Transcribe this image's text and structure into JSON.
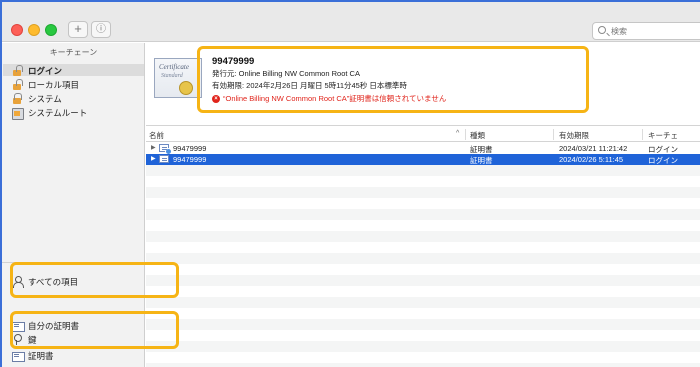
{
  "toolbar": {
    "add_button": "+",
    "info_button": "ⓘ",
    "search_placeholder": "検索"
  },
  "sidebar": {
    "keychains_header": "キーチェーン",
    "keychains": [
      {
        "label": "ログイン",
        "icon": "lock-open-icon"
      },
      {
        "label": "ローカル項目",
        "icon": "lock-open-icon"
      },
      {
        "label": "システム",
        "icon": "lock-icon"
      },
      {
        "label": "システムルート",
        "icon": "cabinet-icon"
      }
    ],
    "categories": [
      {
        "label": "すべての項目",
        "icon": "people-icon"
      },
      {
        "label": "自分の証明書",
        "icon": "certificate-icon"
      },
      {
        "label": "鍵",
        "icon": "key-icon"
      },
      {
        "label": "証明書",
        "icon": "certificate-icon"
      }
    ]
  },
  "detail": {
    "thumb_title": "Certificate",
    "thumb_sub": "Standard",
    "name": "99479999",
    "issuer": "発行元: Online Billing NW Common Root CA",
    "expires": "有効期限: 2024年2月26日 月曜日 5時11分45秒 日本標準時",
    "error": "“Online Billing NW Common Root CA”証明書は信頼されていません"
  },
  "table": {
    "columns": [
      "名前",
      "種類",
      "有効期限",
      "キーチェ"
    ],
    "rows": [
      {
        "name": "99479999",
        "kind": "証明書",
        "expires": "2024/03/21 11:21:42",
        "keychain": "ログイン",
        "selected": false
      },
      {
        "name": "99479999",
        "kind": "証明書",
        "expires": "2024/02/26 5:11:45",
        "keychain": "ログイン",
        "selected": true
      }
    ]
  },
  "colors": {
    "selection": "#1f63d8",
    "highlight": "#f6b415",
    "error": "#e0241b"
  }
}
